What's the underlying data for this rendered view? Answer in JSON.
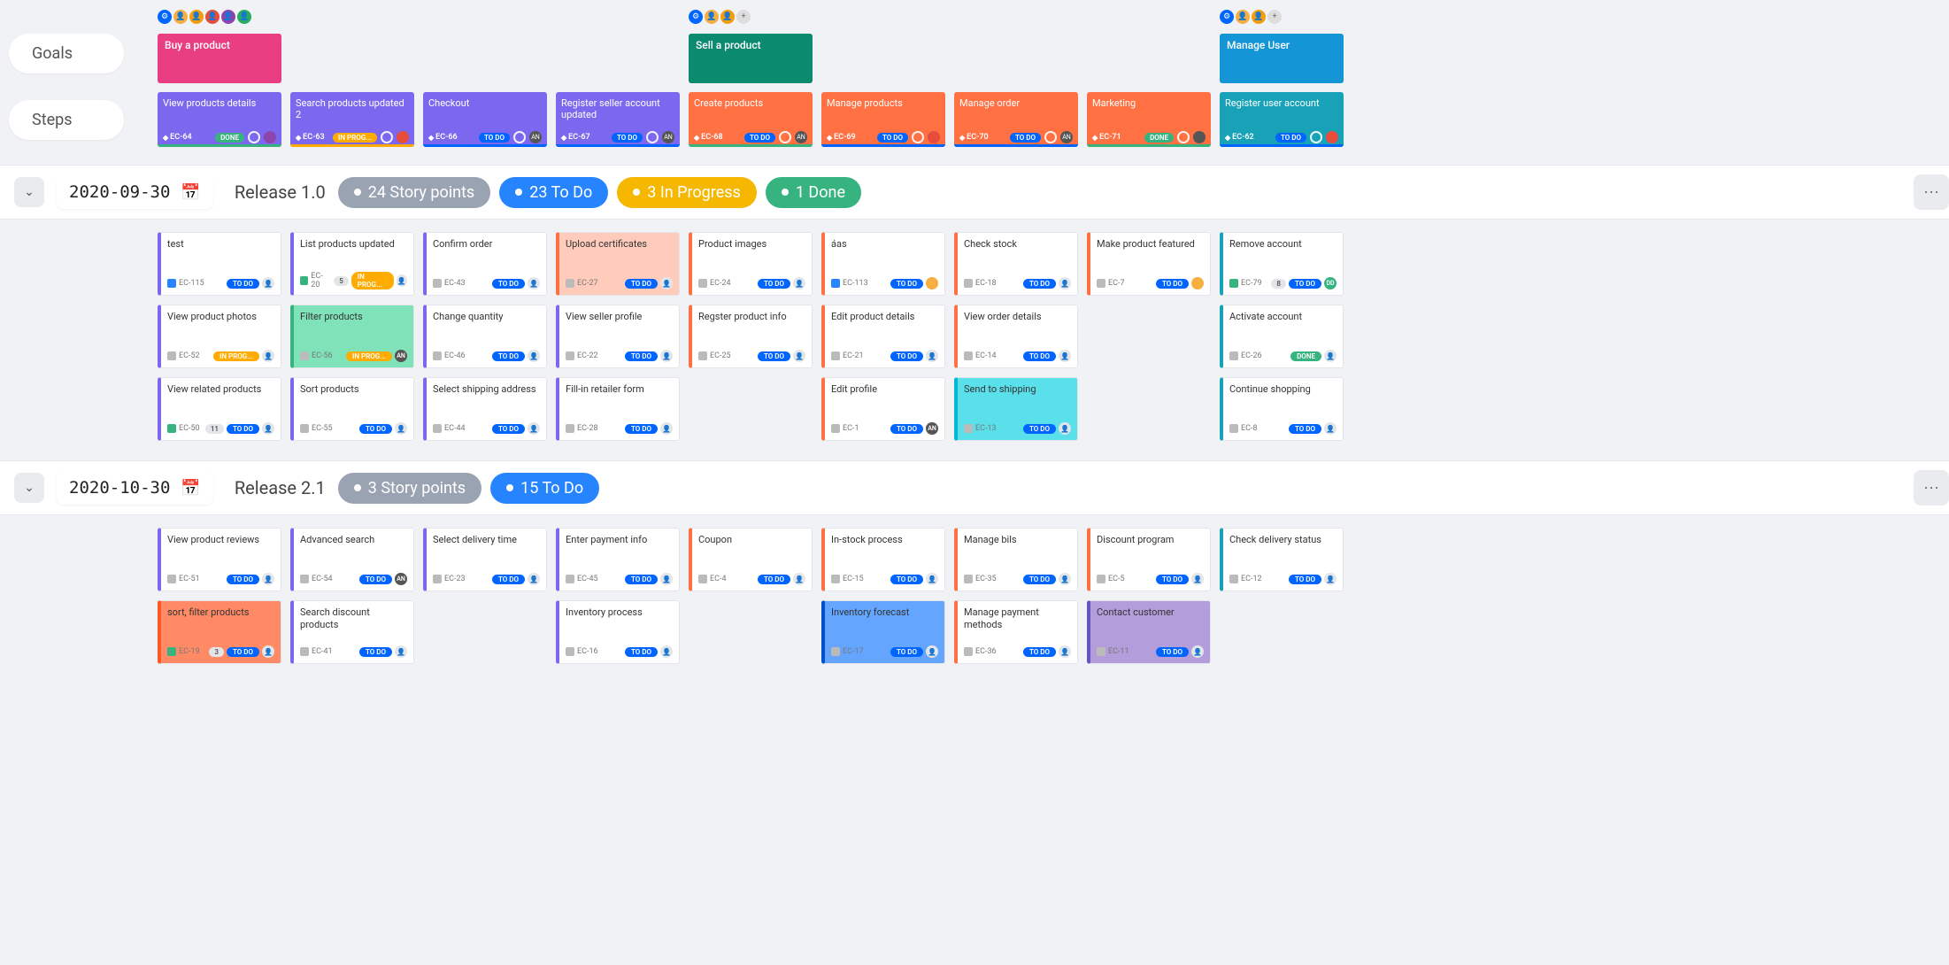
{
  "labels": {
    "goals": "Goals",
    "steps": "Steps"
  },
  "goals": [
    {
      "title": "Buy a product",
      "color": "#ea3e82",
      "avatars": [
        "gear",
        "a1",
        "a2",
        "a3",
        "a4",
        "a5"
      ]
    },
    {
      "title": "Sell a product",
      "color": "#0b8a6f",
      "avatars": [
        "gear",
        "a1",
        "a2",
        "plus"
      ]
    },
    {
      "title": "Manage User",
      "color": "#1395d6",
      "avatars": [
        "gear",
        "a1",
        "a2",
        "plus"
      ]
    }
  ],
  "steps": [
    {
      "title": "View products details",
      "color": "#7b68ee",
      "id": "EC-64",
      "status": "DONE",
      "statusClass": "st-done",
      "border": "#36b37e",
      "avBg": "#8e44ad"
    },
    {
      "title": "Search products updated 2",
      "color": "#7b68ee",
      "id": "EC-63",
      "status": "IN PROG...",
      "statusClass": "st-prog",
      "border": "#ffab00",
      "avBg": "#e74c3c"
    },
    {
      "title": "Checkout",
      "color": "#7b68ee",
      "id": "EC-66",
      "status": "TO DO",
      "statusClass": "st-todo",
      "border": "#0065ff",
      "avText": "AN",
      "avBg": "#555"
    },
    {
      "title": "Register seller account updated",
      "color": "#7b68ee",
      "id": "EC-67",
      "status": "TO DO",
      "statusClass": "st-todo",
      "border": "#0065ff",
      "avText": "AN",
      "avBg": "#555"
    },
    {
      "title": "Create products",
      "color": "#ff7043",
      "id": "EC-68",
      "status": "TO DO",
      "statusClass": "st-todo",
      "border": "#36b37e",
      "avText": "AN",
      "avBg": "#555"
    },
    {
      "title": "Manage products",
      "color": "#ff7043",
      "id": "EC-69",
      "status": "TO DO",
      "statusClass": "st-todo",
      "border": "#0065ff",
      "avBg": "#e74c3c"
    },
    {
      "title": "Manage order",
      "color": "#ff7043",
      "id": "EC-70",
      "status": "TO DO",
      "statusClass": "st-todo",
      "border": "#0065ff",
      "avText": "AN",
      "avBg": "#555"
    },
    {
      "title": "Marketing",
      "color": "#ff7043",
      "id": "EC-71",
      "status": "DONE",
      "statusClass": "st-done",
      "border": "#36b37e",
      "avBg": "#555"
    },
    {
      "title": "Register user account",
      "color": "#17a2b8",
      "id": "EC-62",
      "status": "TO DO",
      "statusClass": "st-todo",
      "border": "#0065ff",
      "avBg": "#e74c3c"
    }
  ],
  "releases": [
    {
      "date": "2020-09-30",
      "name": "Release 1.0",
      "stats": [
        {
          "label": "24 Story points",
          "color": "#9aa3b2"
        },
        {
          "label": "23 To Do",
          "color": "#2684ff"
        },
        {
          "label": "3 In Progress",
          "color": "#f5b700"
        },
        {
          "label": "1 Done",
          "color": "#36b37e"
        }
      ],
      "columns": [
        [
          {
            "title": "test",
            "id": "EC-115",
            "status": "TO DO",
            "statusClass": "st-todo",
            "border": "#7b68ee",
            "typeIcon": "ti-blue",
            "av": "un"
          },
          {
            "title": "View product photos",
            "id": "EC-52",
            "status": "IN PROG...",
            "statusClass": "st-prog",
            "border": "#7b68ee",
            "typeIcon": "ti-gray",
            "av": "un"
          },
          {
            "title": "View related products",
            "id": "EC-50",
            "pts": "11",
            "status": "TO DO",
            "statusClass": "st-todo",
            "border": "#7b68ee",
            "typeIcon": "ti-green",
            "av": "un"
          }
        ],
        [
          {
            "title": "List products updated",
            "id": "EC-20",
            "pts": "5",
            "status": "IN PROG...",
            "statusClass": "st-prog",
            "border": "#7b68ee",
            "typeIcon": "ti-green",
            "av": "un"
          },
          {
            "title": "Filter products",
            "id": "EC-56",
            "status": "IN PROG...",
            "statusClass": "st-prog",
            "border": "#7b68ee",
            "typeIcon": "ti-gray",
            "hl": "hl-mint",
            "avBg": "#555",
            "avText": "AN"
          },
          {
            "title": "Sort products",
            "id": "EC-55",
            "status": "TO DO",
            "statusClass": "st-todo",
            "border": "#7b68ee",
            "typeIcon": "ti-gray",
            "av": "un"
          }
        ],
        [
          {
            "title": "Confirm order",
            "id": "EC-43",
            "status": "TO DO",
            "statusClass": "st-todo",
            "border": "#7b68ee",
            "typeIcon": "ti-gray",
            "av": "un"
          },
          {
            "title": "Change quantity",
            "id": "EC-46",
            "status": "TO DO",
            "statusClass": "st-todo",
            "border": "#7b68ee",
            "typeIcon": "ti-gray",
            "av": "un"
          },
          {
            "title": "Select shipping address",
            "id": "EC-44",
            "status": "TO DO",
            "statusClass": "st-todo",
            "border": "#7b68ee",
            "typeIcon": "ti-gray",
            "av": "un"
          }
        ],
        [
          {
            "title": "Upload certificates",
            "id": "EC-27",
            "status": "TO DO",
            "statusClass": "st-todo",
            "border": "#7b68ee",
            "typeIcon": "ti-gray",
            "hl": "hl-peach",
            "av": "un"
          },
          {
            "title": "View seller profile",
            "id": "EC-22",
            "status": "TO DO",
            "statusClass": "st-todo",
            "border": "#7b68ee",
            "typeIcon": "ti-gray",
            "av": "un"
          },
          {
            "title": "Fill-in retailer form",
            "id": "EC-28",
            "status": "TO DO",
            "statusClass": "st-todo",
            "border": "#7b68ee",
            "typeIcon": "ti-gray",
            "av": "un"
          }
        ],
        [
          {
            "title": "Product images",
            "id": "EC-24",
            "status": "TO DO",
            "statusClass": "st-todo",
            "border": "#ff7043",
            "typeIcon": "ti-gray",
            "av": "un"
          },
          {
            "title": "Regster product info",
            "id": "EC-25",
            "status": "TO DO",
            "statusClass": "st-todo",
            "border": "#ff7043",
            "typeIcon": "ti-gray",
            "av": "un"
          }
        ],
        [
          {
            "title": "áas",
            "id": "EC-113",
            "status": "TO DO",
            "statusClass": "st-todo",
            "border": "#ff7043",
            "typeIcon": "ti-blue",
            "avBg": "#f5b041"
          },
          {
            "title": "Edit product details",
            "id": "EC-21",
            "status": "TO DO",
            "statusClass": "st-todo",
            "border": "#ff7043",
            "typeIcon": "ti-gray",
            "av": "un"
          },
          {
            "title": "Edit profile",
            "id": "EC-1",
            "status": "TO DO",
            "statusClass": "st-todo",
            "border": "#ff7043",
            "typeIcon": "ti-gray",
            "avBg": "#555",
            "avText": "AN"
          }
        ],
        [
          {
            "title": "Check stock",
            "id": "EC-18",
            "status": "TO DO",
            "statusClass": "st-todo",
            "border": "#ff7043",
            "typeIcon": "ti-gray",
            "av": "un"
          },
          {
            "title": "View order details",
            "id": "EC-14",
            "status": "TO DO",
            "statusClass": "st-todo",
            "border": "#ff7043",
            "typeIcon": "ti-gray",
            "av": "un"
          },
          {
            "title": "Send to shipping",
            "id": "EC-13",
            "status": "TO DO",
            "statusClass": "st-todo",
            "border": "#ff7043",
            "typeIcon": "ti-gray",
            "hl": "hl-cyan",
            "av": "un"
          }
        ],
        [
          {
            "title": "Make product featured",
            "id": "EC-7",
            "status": "TO DO",
            "statusClass": "st-todo",
            "border": "#ff7043",
            "typeIcon": "ti-gray",
            "avBg": "#f5b041"
          }
        ],
        [
          {
            "title": "Remove account",
            "id": "EC-79",
            "pts": "8",
            "status": "TO DO",
            "statusClass": "st-todo",
            "border": "#17a2b8",
            "typeIcon": "ti-green",
            "avBg": "#36b37e",
            "avText": "DD"
          },
          {
            "title": "Activate account",
            "id": "EC-26",
            "status": "DONE",
            "statusClass": "st-done",
            "border": "#17a2b8",
            "typeIcon": "ti-gray",
            "av": "un"
          },
          {
            "title": "Continue shopping",
            "id": "EC-8",
            "status": "TO DO",
            "statusClass": "st-todo",
            "border": "#17a2b8",
            "typeIcon": "ti-gray",
            "av": "un"
          }
        ]
      ]
    },
    {
      "date": "2020-10-30",
      "name": "Release 2.1",
      "stats": [
        {
          "label": "3 Story points",
          "color": "#9aa3b2"
        },
        {
          "label": "15 To Do",
          "color": "#2684ff"
        }
      ],
      "columns": [
        [
          {
            "title": "View product reviews",
            "id": "EC-51",
            "status": "TO DO",
            "statusClass": "st-todo",
            "border": "#7b68ee",
            "typeIcon": "ti-gray",
            "av": "un"
          },
          {
            "title": "sort, filter products",
            "id": "EC-19",
            "pts": "3",
            "status": "TO DO",
            "statusClass": "st-todo",
            "border": "#7b68ee",
            "typeIcon": "ti-green",
            "hl": "hl-orange",
            "av": "un"
          }
        ],
        [
          {
            "title": "Advanced search",
            "id": "EC-54",
            "status": "TO DO",
            "statusClass": "st-todo",
            "border": "#7b68ee",
            "typeIcon": "ti-gray",
            "avBg": "#555",
            "avText": "AN"
          },
          {
            "title": "Search discount products",
            "id": "EC-41",
            "status": "TO DO",
            "statusClass": "st-todo",
            "border": "#7b68ee",
            "typeIcon": "ti-gray",
            "av": "un"
          }
        ],
        [
          {
            "title": "Select delivery time",
            "id": "EC-23",
            "status": "TO DO",
            "statusClass": "st-todo",
            "border": "#7b68ee",
            "typeIcon": "ti-gray",
            "av": "un"
          }
        ],
        [
          {
            "title": "Enter payment info",
            "id": "EC-45",
            "status": "TO DO",
            "statusClass": "st-todo",
            "border": "#7b68ee",
            "typeIcon": "ti-gray",
            "av": "un"
          },
          {
            "title": "Inventory process",
            "id": "EC-16",
            "status": "TO DO",
            "statusClass": "st-todo",
            "border": "#7b68ee",
            "typeIcon": "ti-gray",
            "av": "un"
          }
        ],
        [
          {
            "title": "Coupon",
            "id": "EC-4",
            "status": "TO DO",
            "statusClass": "st-todo",
            "border": "#ff7043",
            "typeIcon": "ti-gray",
            "av": "un"
          }
        ],
        [
          {
            "title": "In-stock process",
            "id": "EC-15",
            "status": "TO DO",
            "statusClass": "st-todo",
            "border": "#ff7043",
            "typeIcon": "ti-gray",
            "av": "un"
          },
          {
            "title": "Inventory forecast",
            "id": "EC-17",
            "status": "TO DO",
            "statusClass": "st-todo",
            "border": "#ff7043",
            "typeIcon": "ti-gray",
            "hl": "hl-blue",
            "av": "un"
          }
        ],
        [
          {
            "title": "Manage bils",
            "id": "EC-35",
            "status": "TO DO",
            "statusClass": "st-todo",
            "border": "#ff7043",
            "typeIcon": "ti-gray",
            "av": "un"
          },
          {
            "title": "Manage payment methods",
            "id": "EC-36",
            "status": "TO DO",
            "statusClass": "st-todo",
            "border": "#ff7043",
            "typeIcon": "ti-gray",
            "av": "un"
          }
        ],
        [
          {
            "title": "Discount program",
            "id": "EC-5",
            "status": "TO DO",
            "statusClass": "st-todo",
            "border": "#ff7043",
            "typeIcon": "ti-gray",
            "av": "un"
          },
          {
            "title": "Contact customer",
            "id": "EC-11",
            "status": "TO DO",
            "statusClass": "st-todo",
            "border": "#ff7043",
            "typeIcon": "ti-gray",
            "hl": "hl-violet",
            "av": "un"
          }
        ],
        [
          {
            "title": "Check delivery status",
            "id": "EC-12",
            "status": "TO DO",
            "statusClass": "st-todo",
            "border": "#17a2b8",
            "typeIcon": "ti-gray",
            "av": "un"
          }
        ]
      ]
    }
  ],
  "goalColumns": [
    0,
    -1,
    -1,
    -1,
    1,
    -1,
    -1,
    -1,
    2
  ]
}
